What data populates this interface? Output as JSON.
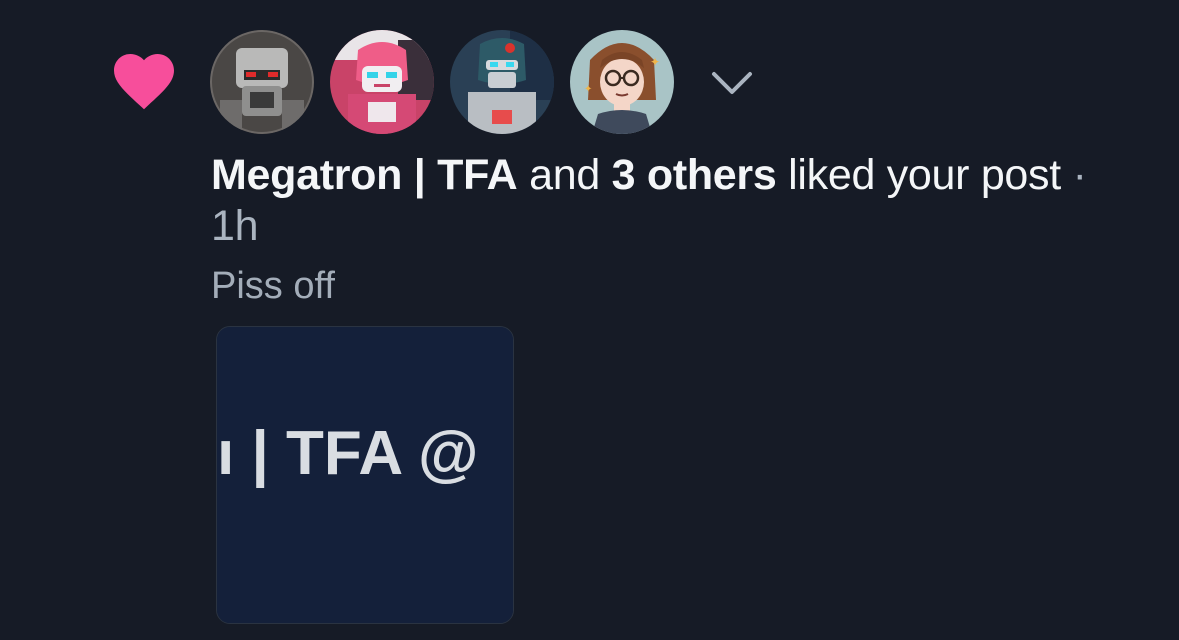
{
  "notification": {
    "icon": "heart-icon",
    "accent_color": "#f74e9b",
    "avatars": [
      {
        "name": "megatron-avatar"
      },
      {
        "name": "arcee-avatar"
      },
      {
        "name": "autobot-avatar"
      },
      {
        "name": "girl-glasses-avatar"
      }
    ],
    "expand_icon": "chevron-down-icon",
    "actor_name": "Megatron | TFA",
    "connector": "and",
    "others": "3 others",
    "action_text": "liked your post",
    "separator": "·",
    "time": "1h",
    "post_text": "Piss off",
    "preview_text": "ı | TFA @"
  }
}
